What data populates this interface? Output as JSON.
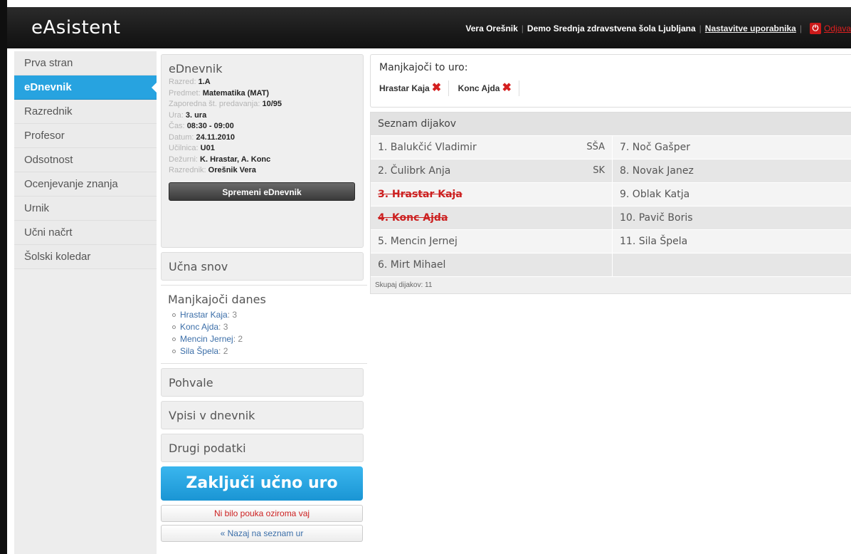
{
  "app": {
    "logo": "eAsistent"
  },
  "header": {
    "user": "Vera Orešnik",
    "school": "Demo Srednja zdravstvena šola Ljubljana",
    "settings_link": "Nastavitve uporabnika",
    "logout_label": "Odjava"
  },
  "sidebar": {
    "items": [
      {
        "label": "Prva stran"
      },
      {
        "label": "eDnevnik",
        "active": true
      },
      {
        "label": "Razrednik"
      },
      {
        "label": "Profesor"
      },
      {
        "label": "Odsotnost"
      },
      {
        "label": "Ocenjevanje znanja"
      },
      {
        "label": "Urnik"
      },
      {
        "label": "Učni načrt"
      },
      {
        "label": "Šolski koledar"
      }
    ]
  },
  "ednevnik": {
    "title": "eDnevnik",
    "fields": [
      {
        "label": "Razred:",
        "value": "1.A"
      },
      {
        "label": "Predmet:",
        "value": "Matematika (MAT)"
      },
      {
        "label": "Zaporedna št. predavanja:",
        "value": "10/95"
      },
      {
        "label": "Ura:",
        "value": "3. ura"
      },
      {
        "label": "Čas:",
        "value": "08:30 - 09:00"
      },
      {
        "label": "Datum:",
        "value": "24.11.2010"
      },
      {
        "label": "Učilnica:",
        "value": "U01"
      },
      {
        "label": "Dežurni:",
        "value": "K. Hrastar, A. Konc"
      },
      {
        "label": "Razrednik:",
        "value": "Orešnik Vera"
      }
    ],
    "change_button": "Spremeni eDnevnik"
  },
  "sections": {
    "ucna_snov": "Učna snov",
    "pohvale": "Pohvale",
    "vpisi": "Vpisi v dnevnik",
    "drugi": "Drugi podatki"
  },
  "absent_today": {
    "title": "Manjkajoči danes",
    "items": [
      {
        "name": "Hrastar Kaja",
        "count": ": 3"
      },
      {
        "name": "Konc Ajda",
        "count": ": 3"
      },
      {
        "name": "Mencin Jernej",
        "count": ": 2"
      },
      {
        "name": "Sila Špela",
        "count": ": 2"
      }
    ]
  },
  "buttons": {
    "close_lesson": "Zaključi učno uro",
    "no_lesson": "Ni bilo pouka oziroma vaj",
    "back": "« Nazaj na seznam ur"
  },
  "missing": {
    "title": "Manjkajoči to uro:",
    "students": [
      "Hrastar Kaja",
      "Konc Ajda"
    ]
  },
  "students": {
    "title": "Seznam dijakov",
    "left": [
      {
        "name": "1. Balukčić Vladimir",
        "badge": "SŠA",
        "absent": false
      },
      {
        "name": "2. Čulibrk Anja",
        "badge": "SK",
        "absent": false
      },
      {
        "name": "3. Hrastar Kaja",
        "badge": "",
        "absent": true
      },
      {
        "name": "4. Konc Ajda",
        "badge": "",
        "absent": true
      },
      {
        "name": "5. Mencin Jernej",
        "badge": "",
        "absent": false
      },
      {
        "name": "6. Mirt Mihael",
        "badge": "",
        "absent": false
      }
    ],
    "right": [
      {
        "name": "7. Noč Gašper"
      },
      {
        "name": "8. Novak Janez"
      },
      {
        "name": "9. Oblak Katja"
      },
      {
        "name": "10. Pavič Boris"
      },
      {
        "name": "11. Sila Špela"
      },
      {
        "name": ""
      }
    ],
    "footer": "Skupaj dijakov: 11"
  },
  "colors": {
    "accent": "#27a3e0",
    "absent": "#cc2020",
    "header": "#1a1a1a"
  }
}
